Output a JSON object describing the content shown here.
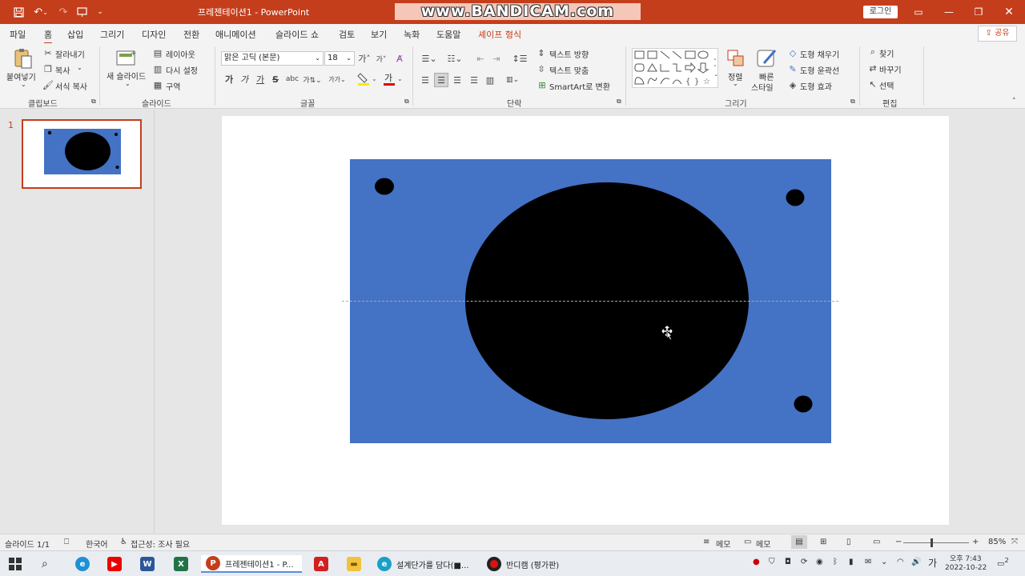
{
  "titlebar": {
    "title": "프레젠테이션1  -  PowerPoint",
    "watermark": "www.BANDICAM.com",
    "login_label": "로그인",
    "qa_icons": [
      "save-icon",
      "undo-icon",
      "redo-icon",
      "present-icon",
      "customize-icon"
    ]
  },
  "menu": {
    "tabs": [
      "파일",
      "홈",
      "삽입",
      "그리기",
      "디자인",
      "전환",
      "애니메이션",
      "슬라이드 쇼",
      "검토",
      "보기",
      "녹화",
      "도움말",
      "셰이프 형식"
    ],
    "active": "홈",
    "share_label": "공유"
  },
  "ribbon": {
    "clipboard": {
      "paste": "붙여넣기",
      "cut": "잘라내기",
      "copy": "복사",
      "format_painter": "서식 복사",
      "label": "클립보드"
    },
    "slides": {
      "new_slide": "새 슬라이드",
      "layout": "레이아웃",
      "reset": "다시 설정",
      "section": "구역",
      "label": "슬라이드"
    },
    "font": {
      "font_name": "맑은 고딕 (본문)",
      "font_size": "18",
      "bold": "가",
      "italic": "가",
      "underline": "가",
      "strike": "S",
      "label": "글꼴"
    },
    "paragraph": {
      "text_direction": "텍스트 방향",
      "align_text": "텍스트 맞춤",
      "smartart": "SmartArt로 변환",
      "label": "단락"
    },
    "drawing": {
      "arrange": "정렬",
      "quick_styles_1": "빠른",
      "quick_styles_2": "스타일",
      "shape_fill": "도형 채우기",
      "shape_outline": "도형 윤곽선",
      "shape_effects": "도형 효과",
      "label": "그리기"
    },
    "editing": {
      "find": "찾기",
      "replace": "바꾸기",
      "select": "선택",
      "label": "편집"
    }
  },
  "thumbnails": {
    "number": "1"
  },
  "slide": {
    "background_color": "#4472c4",
    "shape_color": "#000000"
  },
  "statusbar": {
    "slide_info": "슬라이드 1/1",
    "language": "한국어",
    "accessibility": "접근성: 조사 필요",
    "notes": "메모",
    "comments": "메모",
    "zoom": "85%"
  },
  "taskbar": {
    "ppt_label": "프레젠테이션1 - P...",
    "edge_label": "설계단가를 담다(■...",
    "bandicam_label": "반디캠 (평가판)",
    "ime": "가",
    "time": "오후 7:43",
    "date": "2022-10-22",
    "notification_count": "2"
  }
}
